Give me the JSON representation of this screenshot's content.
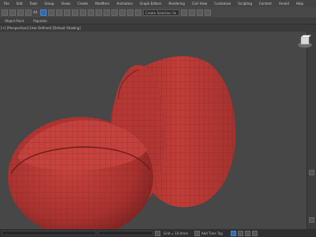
{
  "menubar": {
    "items": [
      "File",
      "Edit",
      "Tools",
      "Group",
      "Views",
      "Create",
      "Modifiers",
      "Animation",
      "Graph Editors",
      "Rendering",
      "Civil View",
      "Customize",
      "Scripting",
      "Content",
      "Arnold",
      "Help"
    ]
  },
  "toolbar": {
    "filter_text": "All",
    "selection_set_placeholder": "Create Selection Se"
  },
  "ribbon": {
    "tabs": [
      "Object Paint",
      "Populate"
    ]
  },
  "viewport": {
    "label": "[+] [Perspective] [User Defined] [Default Shading]"
  },
  "colors": {
    "model": "#b83a36",
    "accent": "#2f6bb0"
  },
  "icons": [
    "undo-icon",
    "redo-icon",
    "link-icon",
    "unlink-icon",
    "select-icon",
    "move-icon",
    "rotate-icon",
    "scale-icon",
    "snap-icon",
    "render-icon",
    "viewcube-icon"
  ],
  "statusbar": {
    "grid_text": "Grid = 10.0mm",
    "tag_text": "Add Time Tag"
  }
}
